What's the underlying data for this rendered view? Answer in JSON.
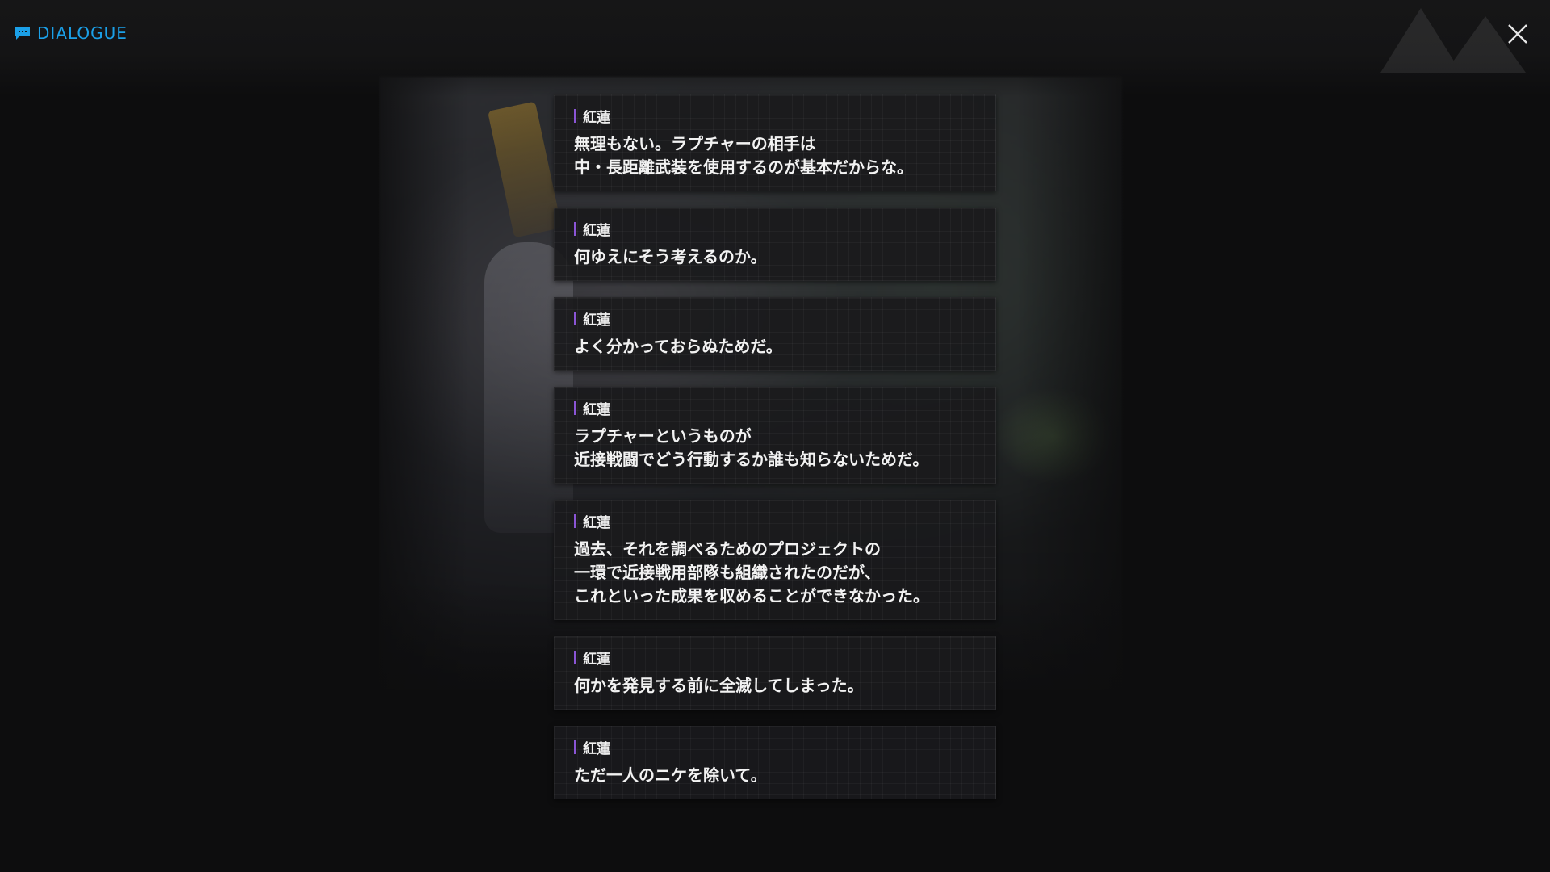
{
  "header": {
    "title": "DIALOGUE",
    "title_icon": "chat-bubble-icon",
    "close_icon": "close-icon",
    "accent_color": "#1ba0e8"
  },
  "speaker_bar_color": "#8b55d6",
  "dialogues": [
    {
      "speaker": "紅蓮",
      "text": "無理もない。ラプチャーの相手は\n中・長距離武装を使用するのが基本だからな。"
    },
    {
      "speaker": "紅蓮",
      "text": "何ゆえにそう考えるのか。"
    },
    {
      "speaker": "紅蓮",
      "text": "よく分かっておらぬためだ。"
    },
    {
      "speaker": "紅蓮",
      "text": "ラプチャーというものが\n近接戦闘でどう行動するか誰も知らないためだ。"
    },
    {
      "speaker": "紅蓮",
      "text": "過去、それを調べるためのプロジェクトの\n一環で近接戦用部隊も組織されたのだが、\nこれといった成果を収めることができなかった。"
    },
    {
      "speaker": "紅蓮",
      "text": "何かを発見する前に全滅してしまった。"
    },
    {
      "speaker": "紅蓮",
      "text": "ただ一人のニケを除いて。"
    }
  ]
}
